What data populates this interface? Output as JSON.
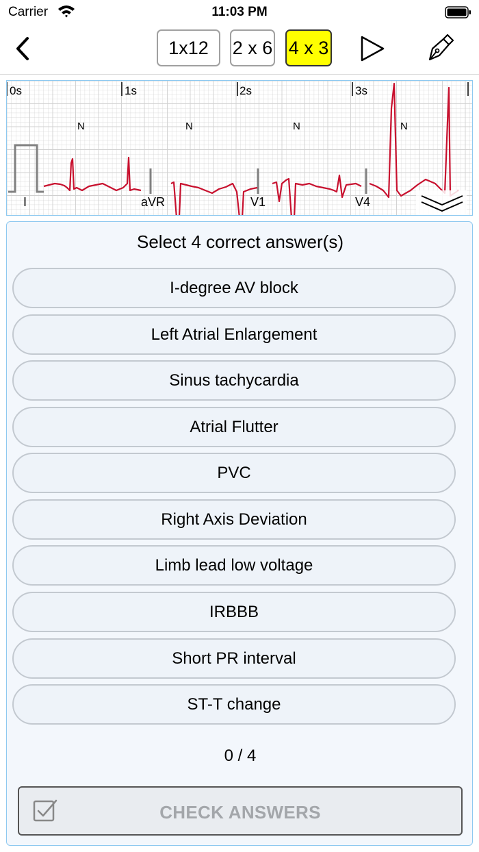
{
  "status_bar": {
    "carrier": "Carrier",
    "time": "11:03 PM"
  },
  "toolbar": {
    "layout_buttons": [
      "1x12",
      "2 x 6",
      "4 x 3"
    ],
    "active_layout": "4 x 3"
  },
  "ecg": {
    "time_marks": [
      "0s",
      "1s",
      "2s",
      "3s"
    ],
    "beat_labels": [
      "N",
      "N",
      "N",
      "N"
    ],
    "lead_labels": [
      "I",
      "aVR",
      "V1",
      "V4"
    ],
    "trace_color": "#c8102e",
    "grid_color": "#d0d0d0"
  },
  "quiz": {
    "title": "Select 4 correct answer(s)",
    "options": [
      "I-degree AV block",
      "Left Atrial Enlargement",
      "Sinus tachycardia",
      "Atrial Flutter",
      "PVC",
      "Right Axis Deviation",
      "Limb lead low voltage",
      "IRBBB",
      "Short PR interval",
      "ST-T change"
    ],
    "score": "0 / 4",
    "check_label": "CHECK ANSWERS"
  }
}
